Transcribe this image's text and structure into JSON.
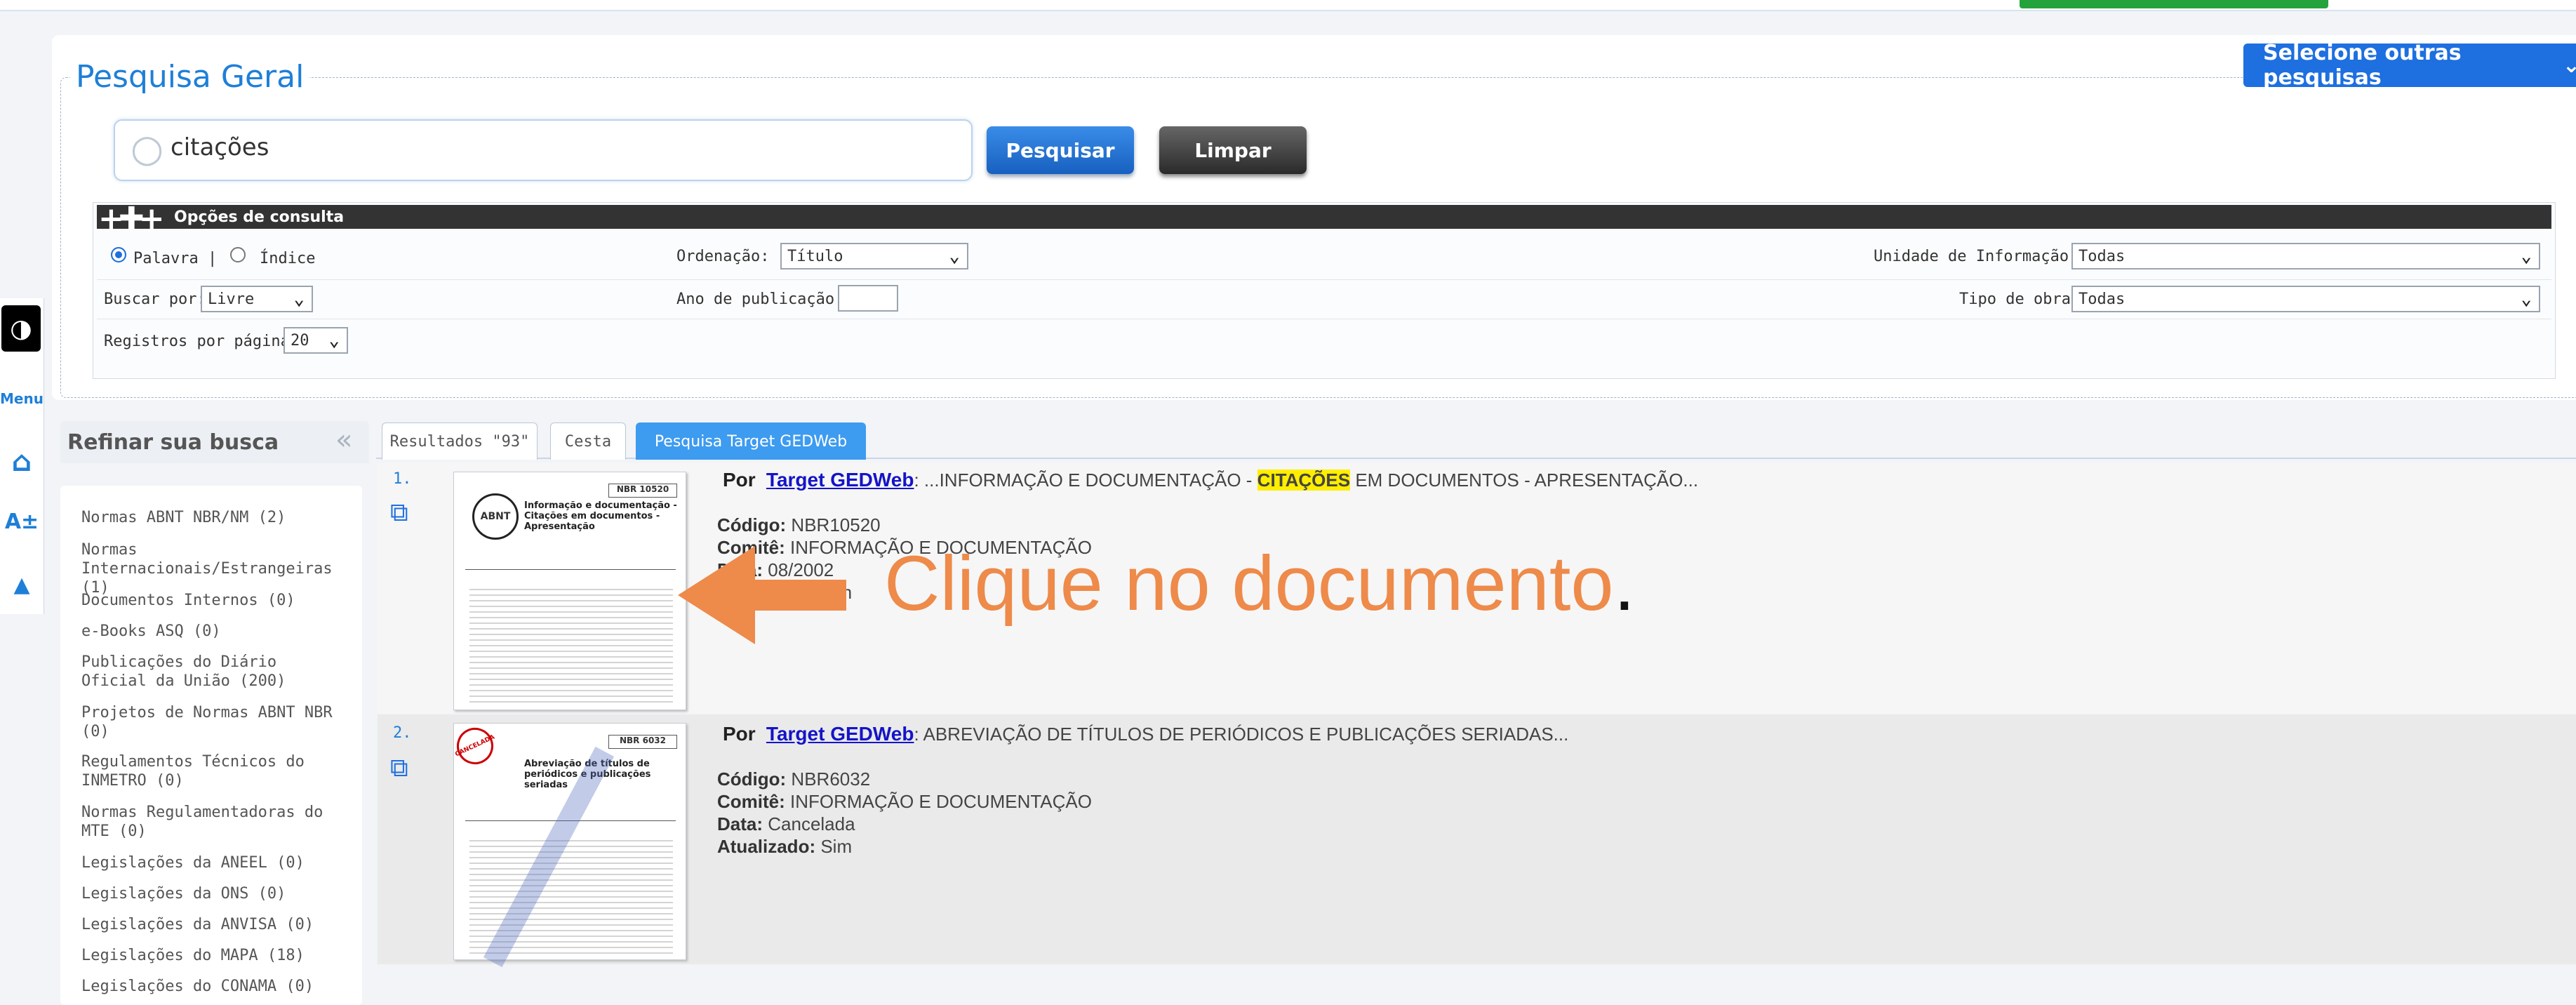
{
  "search": {
    "title": "Pesquisa Geral",
    "other_searches_label": "Selecione outras pesquisas",
    "query_value": "citações",
    "search_button": "Pesquisar",
    "clear_button": "Limpar"
  },
  "options": {
    "header": "Opções de consulta",
    "mode_word": "Palavra |",
    "mode_index": "Índice",
    "ordering_label": "Ordenação:",
    "ordering_value": "Título",
    "unit_label": "Unidade de Informação:",
    "unit_value": "Todas",
    "search_by_label": "Buscar por:",
    "search_by_value": "Livre",
    "year_label": "Ano de publicação:",
    "year_value": "",
    "work_type_label": "Tipo de obra:",
    "work_type_value": "Todas",
    "per_page_label": "Registros por página:",
    "per_page_value": "20"
  },
  "accessibility": {
    "menu_label": "Menu",
    "font_label": "A±"
  },
  "refine": {
    "title": "Refinar sua busca",
    "items": [
      "Normas ABNT NBR/NM (2)",
      "Normas Internacionais/Estrangeiras (1)",
      "Documentos Internos (0)",
      "e-Books ASQ (0)",
      "Publicações do Diário Oficial da União (200)",
      "Projetos de Normas ABNT NBR (0)",
      "Regulamentos Técnicos do INMETRO (0)",
      "Normas Regulamentadoras do MTE (0)",
      "Legislações da ANEEL (0)",
      "Legislações da ONS (0)",
      "Legislações da ANVISA (0)",
      "Legislações do MAPA (18)",
      "Legislações do CONAMA (0)"
    ]
  },
  "tabs": {
    "results": "Resultados \"93\"",
    "basket": "Cesta",
    "target": "Pesquisa Target GEDWeb"
  },
  "results": [
    {
      "number": "1.",
      "por": "Por",
      "source": "Target GEDWeb",
      "title_pre": ": ...INFORMAÇÃO E DOCUMENTAÇÃO - ",
      "title_highlight": "CITAÇÕES",
      "title_post": " EM DOCUMENTOS - APRESENTAÇÃO...",
      "code_label": "Código:",
      "code": "NBR10520",
      "committee_label": "Comitê:",
      "committee": "INFORMAÇÃO E DOCUMENTAÇÃO",
      "date_label": "Data:",
      "date": "08/2002",
      "updated_label": "Atualizado:",
      "updated": "Sim",
      "thumb_code": "NBR 10520",
      "thumb_title": "Informação e documentação - Citações em documentos - Apresentação",
      "thumb_logo": "ABNT"
    },
    {
      "number": "2.",
      "por": "Por",
      "source": "Target GEDWeb",
      "title_pre": ": ABREVIAÇÃO DE TÍTULOS DE PERIÓDICOS E PUBLICAÇÕES SERIADAS...",
      "code_label": "Código:",
      "code": "NBR6032",
      "committee_label": "Comitê:",
      "committee": "INFORMAÇÃO E DOCUMENTAÇÃO",
      "date_label": "Data:",
      "date": "Cancelada",
      "updated_label": "Atualizado:",
      "updated": "Sim",
      "thumb_code": "NBR 6032",
      "thumb_title": "Abreviação de títulos de periódicos e publicações seriadas",
      "thumb_stamp": "CANCELADA"
    }
  ],
  "annotation": {
    "text": "Clique no documento",
    "dot": ".",
    "color": "#ee8a4a"
  }
}
